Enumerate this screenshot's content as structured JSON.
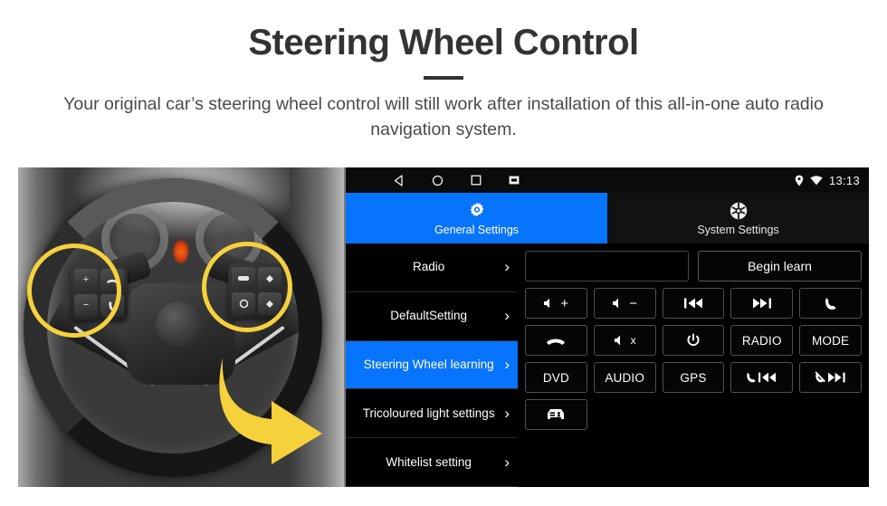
{
  "header": {
    "title": "Steering Wheel Control",
    "subtitle": "Your original car’s steering wheel control will still work after installation of this all-in-one auto radio navigation system."
  },
  "colors": {
    "accent_blue": "#0674FC",
    "highlight_yellow": "#F5D13C",
    "title_gray": "#333333",
    "screen_black": "#000000"
  },
  "photo": {
    "alt_name": "steering-wheel-photo",
    "left_pad_keys": [
      "volume-up",
      "phone-hangup-icon",
      "volume-down",
      "phone-call-icon"
    ],
    "right_pad_keys": [
      "media-icon",
      "diamond-up-icon",
      "circle-icon",
      "diamond-down-icon"
    ],
    "highlight_circles": 2,
    "arrow_direction": "right"
  },
  "unit": {
    "statusbar": {
      "nav": [
        "back-icon",
        "home-icon",
        "recents-icon",
        "screenshot-icon"
      ],
      "location_icon": "location-pin-icon",
      "wifi_icon": "wifi-icon",
      "clock": "13:13"
    },
    "tabs": [
      {
        "label": "General Settings",
        "icon": "gear-icon",
        "active": true
      },
      {
        "label": "System Settings",
        "icon": "system-emblem-icon",
        "active": false
      }
    ],
    "sidebar": [
      {
        "label": "Radio",
        "active": false
      },
      {
        "label": "DefaultSetting",
        "active": false
      },
      {
        "label": "Steering Wheel learning",
        "active": true
      },
      {
        "label": "Tricoloured light settings",
        "active": false
      },
      {
        "label": "Whitelist setting",
        "active": false
      }
    ],
    "learn": {
      "field_value": "",
      "field_placeholder": "",
      "begin_label": "Begin learn"
    },
    "buttons": [
      {
        "label": "",
        "icon": "volume-up-icon"
      },
      {
        "label": "",
        "icon": "volume-down-icon"
      },
      {
        "label": "",
        "icon": "previous-track-icon"
      },
      {
        "label": "",
        "icon": "next-track-icon"
      },
      {
        "label": "",
        "icon": "phone-call-icon"
      },
      {
        "label": "",
        "icon": "phone-hangup-icon"
      },
      {
        "label": "",
        "icon": "volume-mute-icon"
      },
      {
        "label": "",
        "icon": "power-icon"
      },
      {
        "label": "RADIO",
        "icon": ""
      },
      {
        "label": "MODE",
        "icon": ""
      },
      {
        "label": "DVD",
        "icon": ""
      },
      {
        "label": "AUDIO",
        "icon": ""
      },
      {
        "label": "GPS",
        "icon": ""
      },
      {
        "label": "",
        "icon": "phone-previous-icon"
      },
      {
        "label": "",
        "icon": "phone-decline-next-icon"
      },
      {
        "label": "",
        "icon": "car-front-icon"
      }
    ]
  }
}
